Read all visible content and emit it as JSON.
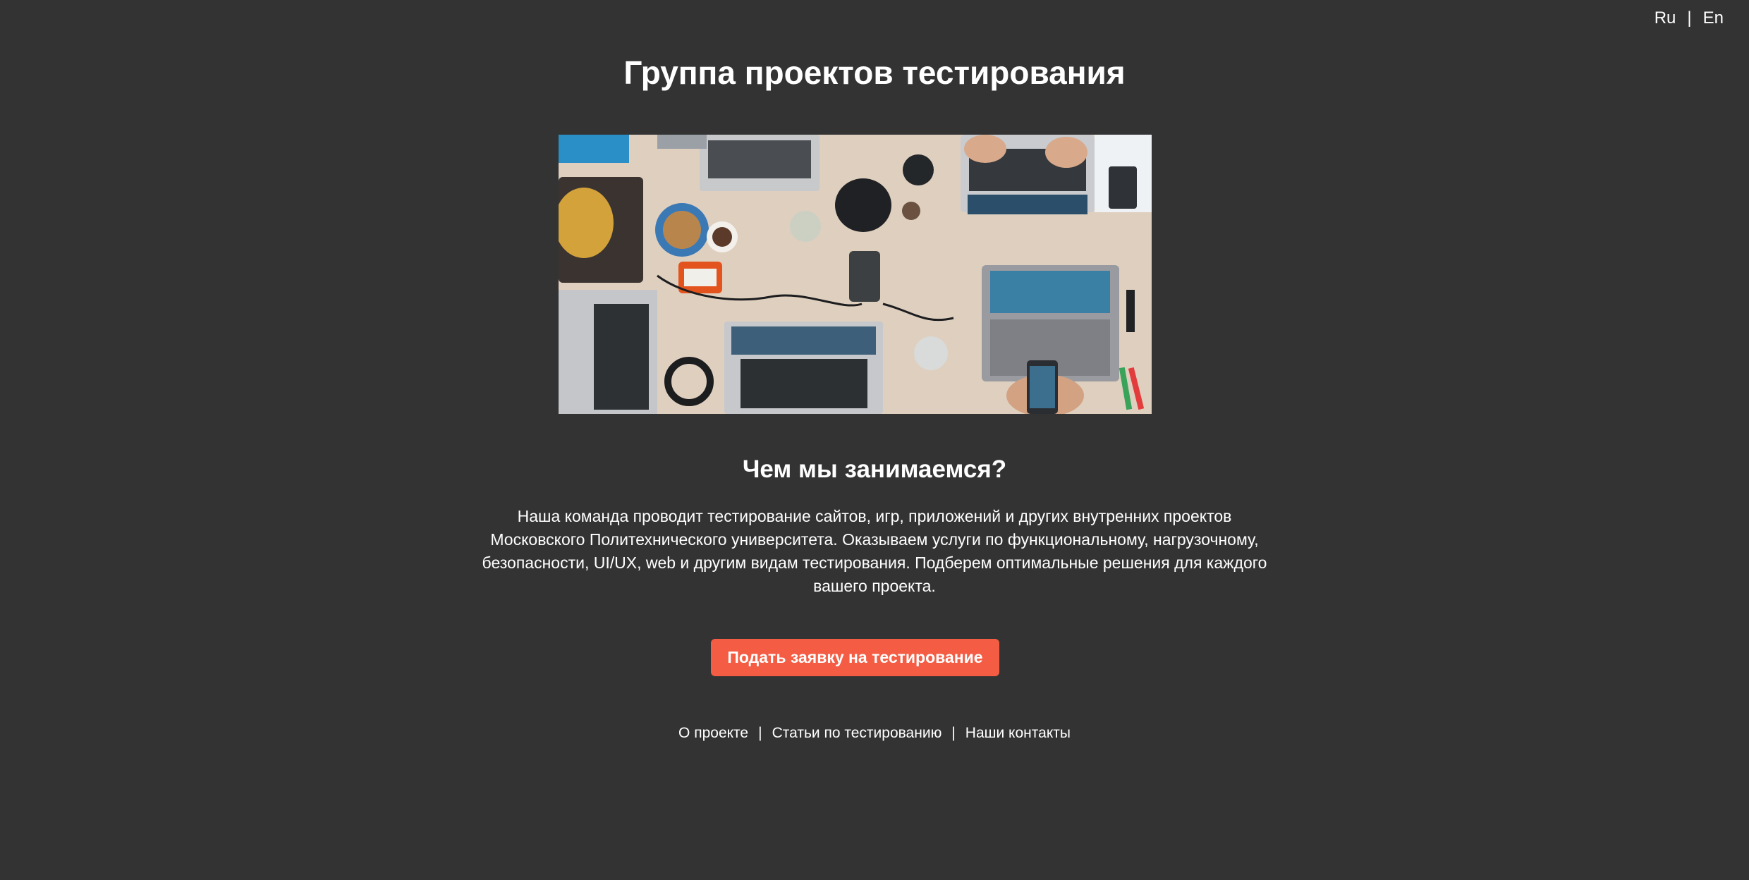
{
  "lang": {
    "ru": "Ru",
    "separator": "|",
    "en": "En"
  },
  "header": {
    "title": "Группа проектов тестирования"
  },
  "hero": {
    "alt": "Рабочий стол с ноутбуками"
  },
  "about": {
    "title": "Чем мы занимаемся?",
    "text": "Наша команда проводит тестирование сайтов, игр, приложений и других внутренних проектов Московского Политехнического университета. Оказываем услуги по функциональному, нагрузочному, безопасности, UI/UX, web и другим видам тестирования. Подберем оптимальные решения для каждого вашего проекта."
  },
  "cta": {
    "label": "Подать заявку на тестирование",
    "color": "#f45c43"
  },
  "footer": {
    "links": [
      "О проекте",
      "Статьи по тестированию",
      "Наши контакты"
    ],
    "separator": "|"
  },
  "colors": {
    "background": "#333333",
    "text": "#ffffff",
    "accent": "#f45c43"
  }
}
